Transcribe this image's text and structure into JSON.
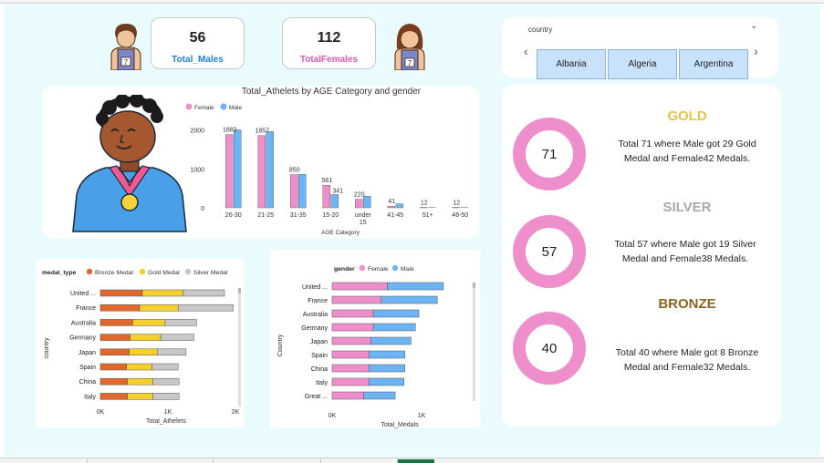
{
  "kpis": {
    "males": {
      "value": "56",
      "label": "Total_Males",
      "color": "#1f7fd6"
    },
    "females": {
      "value": "112",
      "label": "TotalFemales",
      "color": "#d95bb0"
    }
  },
  "slicer": {
    "title": "country",
    "items": [
      "Albania",
      "Algeria",
      "Argentina"
    ]
  },
  "colors": {
    "female": "#ee8fcb",
    "male": "#6cb4f3",
    "bronze": "#e0682c",
    "gold": "#f5d02c",
    "silver": "#c8c8c8",
    "gold_title": "#e6c24a",
    "silver_title": "#a9a9a9",
    "bronze_title": "#8b6420"
  },
  "medals": [
    {
      "title": "GOLD",
      "total": 71,
      "male": 29,
      "female": 42,
      "value_label": "71",
      "line1": "Total 71 where Male got 29 Gold",
      "line2": "Medal and Female42 Medals."
    },
    {
      "title": "SILVER",
      "total": 57,
      "male": 19,
      "female": 38,
      "value_label": "57",
      "line1": "Total 57 where Male got 19 Silver",
      "line2": "Medal and Female38 Medals."
    },
    {
      "title": "BRONZE",
      "total": 40,
      "male": 8,
      "female": 32,
      "value_label": "40",
      "line1": "Total 40 where Male got 8 Bronze",
      "line2": "Medal and Female32 Medals."
    }
  ],
  "chart_data": [
    {
      "type": "bar",
      "title": "Total_Athelets by AGE Category and gender",
      "xlabel": "AGE Category",
      "ylabel": "",
      "categories": [
        "26-30",
        "21-25",
        "31-35",
        "15-20",
        "under 15",
        "41-45",
        "51+",
        "46-50"
      ],
      "series": [
        {
          "name": "Female",
          "values": [
            1882,
            1857,
            850,
            581,
            220,
            41,
            12,
            12
          ]
        },
        {
          "name": "Male",
          "values": [
            2000,
            1960,
            860,
            341,
            300,
            100,
            0,
            0
          ]
        }
      ],
      "data_labels": [
        "1882",
        "1857",
        "850",
        "581",
        "220",
        "41",
        "12",
        "12"
      ],
      "extra_label": "341",
      "yticks": [
        "2000",
        "1000",
        "0"
      ],
      "ylim": [
        0,
        2200
      ],
      "legend": "top-left"
    },
    {
      "type": "bar",
      "orientation": "horizontal",
      "stacked": true,
      "legend_title": "medal_type",
      "xlabel": "Total_Athelets",
      "ylabel": "country",
      "categories": [
        "United ...",
        "France",
        "Australia",
        "Germany",
        "Japan",
        "Spain",
        "China",
        "Italy"
      ],
      "series": [
        {
          "name": "Bronze Medal",
          "values": [
            480,
            450,
            370,
            340,
            330,
            300,
            310,
            310
          ]
        },
        {
          "name": "Gold Medal",
          "values": [
            470,
            440,
            370,
            350,
            320,
            290,
            290,
            290
          ]
        },
        {
          "name": "Silver Medal",
          "values": [
            470,
            630,
            360,
            380,
            330,
            300,
            300,
            300
          ]
        }
      ],
      "xticks": [
        "0K",
        "1K",
        "2K"
      ],
      "xlim": [
        0,
        1550
      ],
      "legend": "top"
    },
    {
      "type": "bar",
      "orientation": "horizontal",
      "stacked": true,
      "legend_title": "gender",
      "xlabel": "Total_Medals",
      "ylabel": "Country",
      "categories": [
        "United ...",
        "France",
        "Australia",
        "Germany",
        "Japan",
        "Spain",
        "China",
        "Italy",
        "Great ..."
      ],
      "series": [
        {
          "name": "Female",
          "values": [
            630,
            560,
            470,
            470,
            440,
            420,
            420,
            420,
            360
          ]
        },
        {
          "name": "Male",
          "values": [
            640,
            640,
            520,
            480,
            460,
            410,
            410,
            400,
            360
          ]
        }
      ],
      "xticks": [
        "0K",
        "1K"
      ],
      "xlim": [
        0,
        1000
      ],
      "legend": "top"
    }
  ]
}
